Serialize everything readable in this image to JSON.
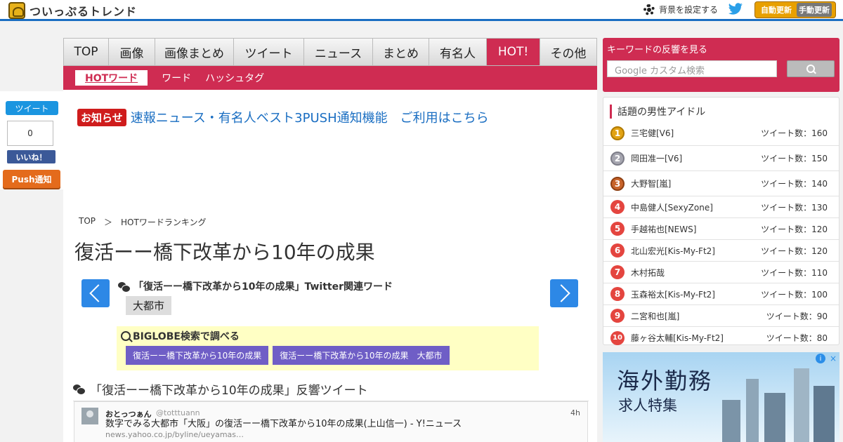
{
  "header": {
    "logo_text": "ついっぷるトレンド",
    "bg_setting": "背景を設定する",
    "update_auto": "自動更新",
    "update_manual": "手動更新"
  },
  "share": {
    "tweet": "ツイート",
    "count": "0",
    "like": "いいね！",
    "push": "Push通知"
  },
  "nav": {
    "items": [
      "TOP",
      "画像",
      "画像まとめ",
      "ツイート",
      "ニュース",
      "まとめ",
      "有名人",
      "HOT!",
      "その他"
    ],
    "active_index": 7
  },
  "subnav": {
    "items": [
      "HOTワード",
      "ワード",
      "ハッシュタグ"
    ]
  },
  "notice": {
    "badge": "お知らせ",
    "text": "速報ニュース・有名人ベスト3PUSH通知機能　ご利用はこちら"
  },
  "breadcrumb": [
    "TOP",
    "＞",
    "HOTワードランキング"
  ],
  "page_title": "復活ーー橋下改革から10年の成果",
  "related": {
    "title": "「復活ーー橋下改革から10年の成果」Twitter関連ワード",
    "tag": "大都市"
  },
  "biglobe": {
    "title": "BIGLOBE検索で調べる",
    "buttons": [
      "復活ーー橋下改革から10年の成果",
      "復活ーー橋下改革から10年の成果　大都市"
    ]
  },
  "reaction": {
    "title": "「復活ーー橋下改革から10年の成果」反響ツイート"
  },
  "tweet": {
    "name": "おとっつぁん",
    "handle": "@totttuann",
    "time": "4h",
    "text": "数字でみる大都市「大阪」の復活ーー橋下改革から10年の成果(上山信一) - Y!ニュース ",
    "link": "news.yahoo.co.jp/byline/ueyamas…"
  },
  "keyword": {
    "title": "キーワードの反響を見る",
    "placeholder": "Google カスタム検索"
  },
  "ranking": {
    "title": "話題の男性アイドル",
    "items": [
      {
        "rank": "1",
        "name": "三宅健[V6]",
        "count": "ツイート数：160"
      },
      {
        "rank": "2",
        "name": "岡田准一[V6]",
        "count": "ツイート数：150"
      },
      {
        "rank": "3",
        "name": "大野智[嵐]",
        "count": "ツイート数：140"
      },
      {
        "rank": "4",
        "name": "中島健人[SexyZone]",
        "count": "ツイート数：130"
      },
      {
        "rank": "5",
        "name": "手越祐也[NEWS]",
        "count": "ツイート数：120"
      },
      {
        "rank": "6",
        "name": "北山宏光[Kis-My-Ft2]",
        "count": "ツイート数：120"
      },
      {
        "rank": "7",
        "name": "木村拓哉",
        "count": "ツイート数：110"
      },
      {
        "rank": "8",
        "name": "玉森裕太[Kis-My-Ft2]",
        "count": "ツイート数：100"
      },
      {
        "rank": "9",
        "name": "二宮和也[嵐]",
        "count": "ツイート数：90"
      },
      {
        "rank": "10",
        "name": "藤ヶ谷太輔[Kis-My-Ft2]",
        "count": "ツイート数：80"
      }
    ]
  },
  "ad": {
    "title": "海外勤務",
    "subtitle": "求人特集",
    "info": "i",
    "close": "×"
  },
  "colors": {
    "accent": "#cf2c52",
    "link": "#1a6ec2",
    "search_button": "#6f5ec6"
  }
}
